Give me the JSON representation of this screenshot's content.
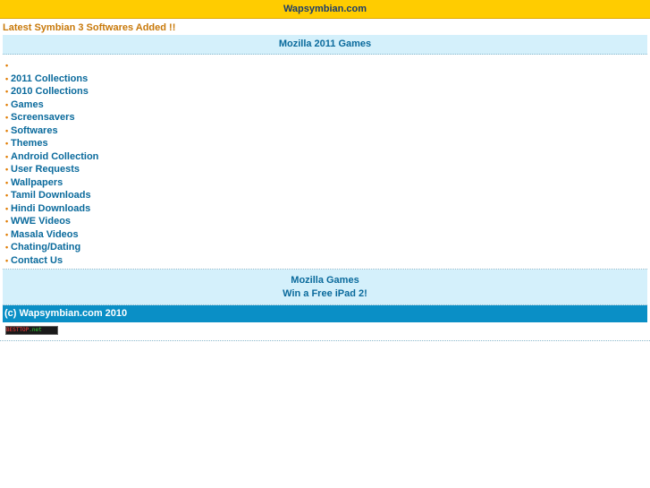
{
  "header": {
    "title": "Wapsymbian.com"
  },
  "announcement": "Latest Symbian 3 Softwares Added !!",
  "promo_top": {
    "label": "Mozilla 2011 Games"
  },
  "menu": {
    "bullet": "•",
    "items": [
      {
        "label": ""
      },
      {
        "label": "2011 Collections"
      },
      {
        "label": "2010 Collections"
      },
      {
        "label": "Games"
      },
      {
        "label": "Screensavers"
      },
      {
        "label": "Softwares"
      },
      {
        "label": "Themes"
      },
      {
        "label": "Android Collection"
      },
      {
        "label": "User Requests"
      },
      {
        "label": "Wallpapers"
      },
      {
        "label": "Tamil Downloads"
      },
      {
        "label": "Hindi Downloads"
      },
      {
        "label": "WWE Videos"
      },
      {
        "label": "Masala Videos"
      },
      {
        "label": "Chating/Dating"
      },
      {
        "label": "Contact Us"
      }
    ]
  },
  "promo_bottom": {
    "line1": "Mozilla Games",
    "line2": "Win a Free iPad 2!"
  },
  "footer": {
    "copyright": "(c) Wapsymbian.com 2010"
  },
  "counter_badge": {
    "text_red": "BESTTOP",
    "text_green": ".net"
  },
  "colors": {
    "topbar": "#ffcc00",
    "link": "#0a6a9c",
    "bullet": "#e07b00",
    "announce": "#c8790a",
    "promo_bg": "#d4f0fb",
    "footer_bg": "#0a8fc6"
  }
}
